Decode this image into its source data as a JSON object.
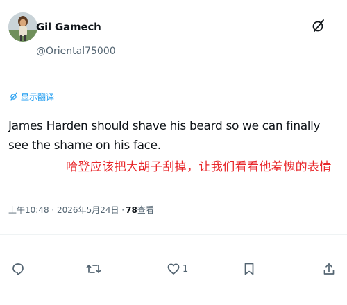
{
  "author": {
    "display_name": "Gil Gamech",
    "handle": "@Oriental75000"
  },
  "translate_label": "显示翻译",
  "post": {
    "text": "James Harden should shave his beard so we can finally see the shame on his face.",
    "overlay_translation": "哈登应该把大胡子刮掉，让我们看看他羞愧的表情"
  },
  "meta": {
    "timestamp": "上午10:48 · 2026年5月24日 · ",
    "views_count": "78",
    "views_label": " 查看"
  },
  "actions": {
    "like_count": "1"
  },
  "colors": {
    "accent": "#1d9bf0",
    "overlay_text": "#e8262a",
    "secondary_text": "#536471"
  },
  "icons": [
    "grok-icon",
    "translate-icon",
    "reply-icon",
    "repost-icon",
    "like-icon",
    "bookmark-icon",
    "share-icon"
  ]
}
